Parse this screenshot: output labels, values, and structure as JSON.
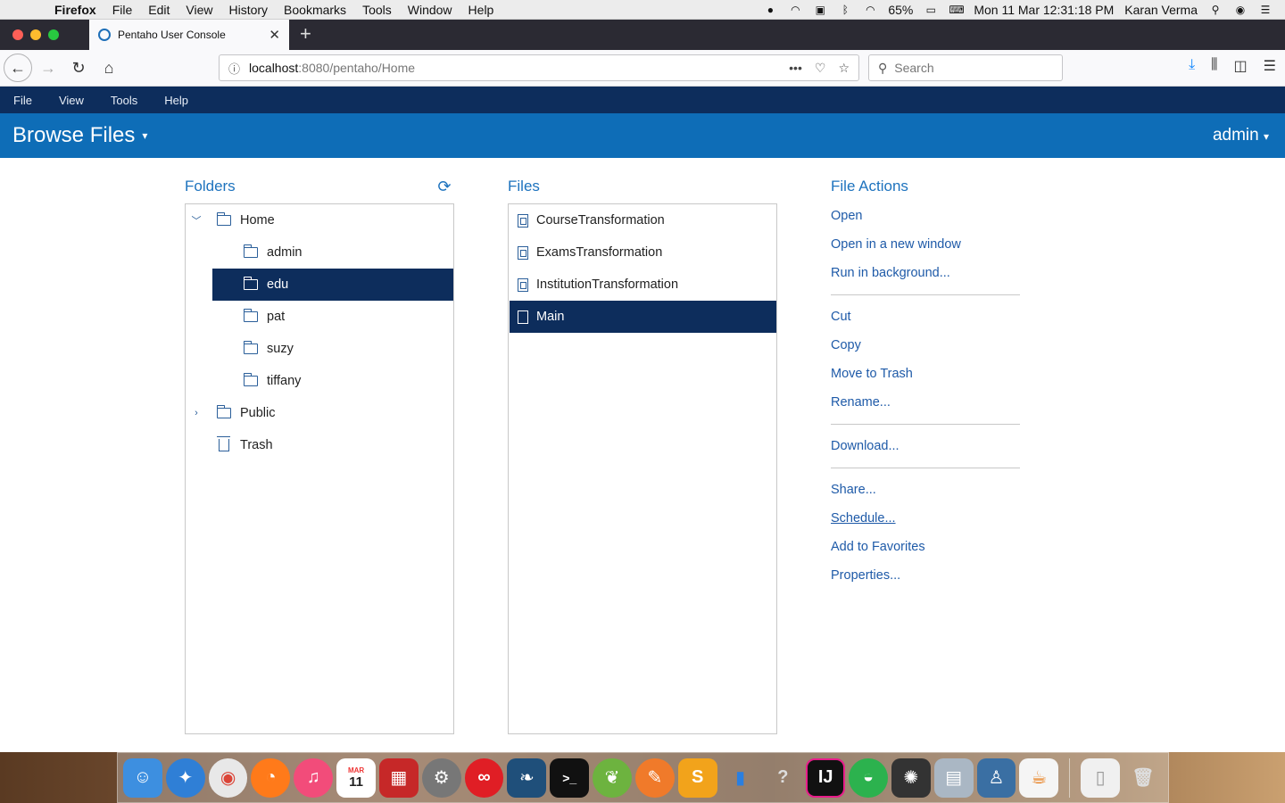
{
  "mac_menubar": {
    "app_name": "Firefox",
    "menus": [
      "File",
      "Edit",
      "View",
      "History",
      "Bookmarks",
      "Tools",
      "Window",
      "Help"
    ],
    "battery": "65%",
    "clock": "Mon 11 Mar  12:31:18 PM",
    "user": "Karan Verma"
  },
  "browser": {
    "tab_title": "Pentaho User Console",
    "url_host": "localhost",
    "url_path": ":8080/pentaho/Home",
    "search_placeholder": "Search"
  },
  "app": {
    "menus": [
      "File",
      "View",
      "Tools",
      "Help"
    ],
    "header_title": "Browse Files",
    "user_menu": "admin"
  },
  "folders": {
    "title": "Folders",
    "items": [
      {
        "label": "Home",
        "expander": "open"
      },
      {
        "label": "admin"
      },
      {
        "label": "edu",
        "selected": true
      },
      {
        "label": "pat"
      },
      {
        "label": "suzy"
      },
      {
        "label": "tiffany"
      },
      {
        "label": "Public",
        "expander": "closed"
      },
      {
        "label": "Trash"
      }
    ]
  },
  "files": {
    "title": "Files",
    "items": [
      {
        "label": "CourseTransformation"
      },
      {
        "label": "ExamsTransformation"
      },
      {
        "label": "InstitutionTransformation"
      },
      {
        "label": "Main",
        "selected": true
      }
    ]
  },
  "file_actions": {
    "title": "File Actions",
    "open": "Open",
    "open_new_window": "Open in a new window",
    "run_background": "Run in background...",
    "cut": "Cut",
    "copy": "Copy",
    "move_trash": "Move to Trash",
    "rename": "Rename...",
    "download": "Download...",
    "share": "Share...",
    "schedule": "Schedule...",
    "add_favorites": "Add to Favorites",
    "properties": "Properties..."
  },
  "dock": {
    "calendar_month": "MAR",
    "calendar_day": "11"
  },
  "colors": {
    "app_menubar": "#0d2d5c",
    "header": "#0e6db7",
    "selection": "#0d2d5c",
    "link": "#1e5aa8"
  }
}
